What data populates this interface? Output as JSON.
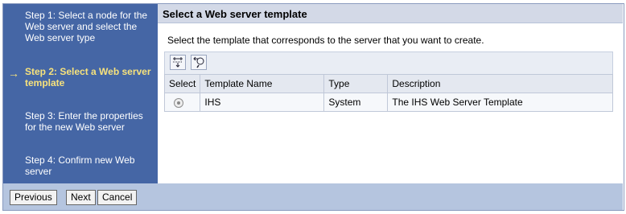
{
  "steps": [
    {
      "text": "Step 1: Select a node for the Web server and select the Web server type"
    },
    {
      "text": "Step 2: Select a Web server template",
      "current": true
    },
    {
      "text": "Step 3: Enter the properties for the new Web server"
    },
    {
      "text": "Step 4: Confirm new Web server"
    }
  ],
  "current_arrow": "→",
  "title": "Select a Web server template",
  "instruction": "Select the template that corresponds to the server that you want to create.",
  "toolbar_icons": [
    "select-all-icon",
    "filter-icon"
  ],
  "table": {
    "headers": [
      "Select",
      "Template Name",
      "Type",
      "Description"
    ],
    "rows": [
      {
        "template_name": "IHS",
        "type": "System",
        "description": "The IHS Web Server Template",
        "selected": true
      }
    ]
  },
  "buttons": {
    "previous": "Previous",
    "next": "Next",
    "cancel": "Cancel"
  }
}
